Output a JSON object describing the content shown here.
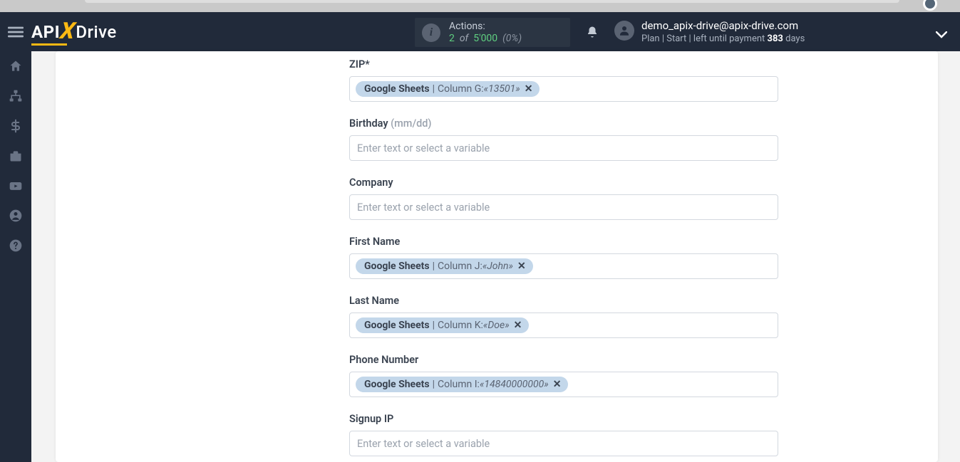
{
  "header": {
    "logo": {
      "p1": "API",
      "p2": "X",
      "p3": "Drive"
    },
    "actions": {
      "title": "Actions:",
      "used": "2",
      "of_word": "of",
      "total": "5'000",
      "pct": "(0%)"
    },
    "user": {
      "email": "demo_apix-drive@apix-drive.com",
      "plan_prefix": "Plan |",
      "plan_name": "Start",
      "plan_mid": "|  left until payment ",
      "days_num": "383",
      "days_word": " days"
    }
  },
  "fields": [
    {
      "key": "zip",
      "label": "ZIP*",
      "hint": "",
      "placeholder": "",
      "tag": {
        "source": "Google Sheets",
        "column": "Column G:",
        "value": "«13501»"
      }
    },
    {
      "key": "birthday",
      "label": "Birthday ",
      "hint": "(mm/dd)",
      "placeholder": "Enter text or select a variable",
      "tag": null
    },
    {
      "key": "company",
      "label": "Company",
      "hint": "",
      "placeholder": "Enter text or select a variable",
      "tag": null
    },
    {
      "key": "first_name",
      "label": "First Name",
      "hint": "",
      "placeholder": "",
      "tag": {
        "source": "Google Sheets",
        "column": "Column J:",
        "value": "«John»"
      }
    },
    {
      "key": "last_name",
      "label": "Last Name",
      "hint": "",
      "placeholder": "",
      "tag": {
        "source": "Google Sheets",
        "column": "Column K:",
        "value": "«Doe»"
      }
    },
    {
      "key": "phone",
      "label": "Phone Number",
      "hint": "",
      "placeholder": "",
      "tag": {
        "source": "Google Sheets",
        "column": "Column I:",
        "value": "«14840000000»"
      }
    },
    {
      "key": "signup_ip",
      "label": "Signup IP",
      "hint": "",
      "placeholder": "Enter text or select a variable",
      "tag": null
    }
  ]
}
